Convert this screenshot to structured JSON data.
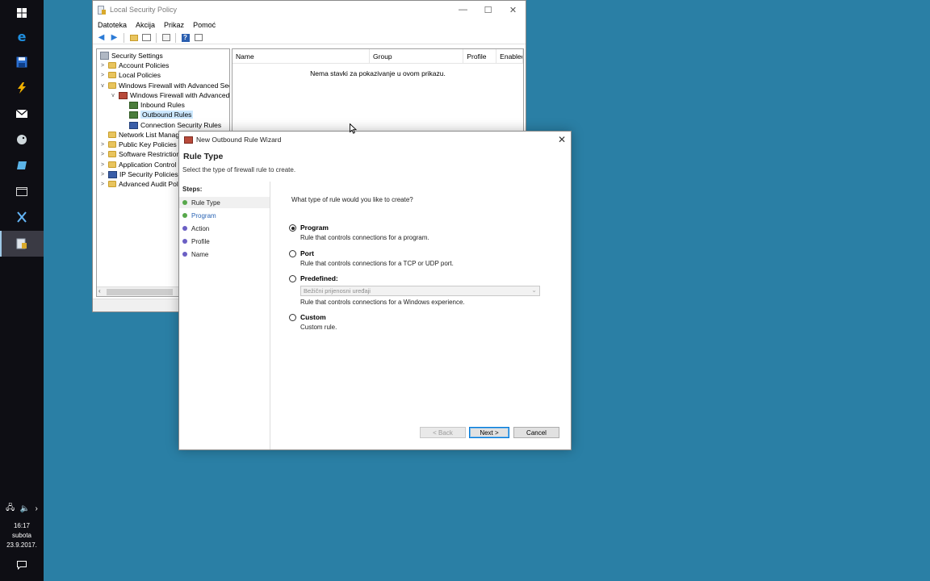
{
  "taskbar": {
    "clock": {
      "time": "16:17",
      "day": "subota",
      "date": "23.9.2017."
    }
  },
  "lsp_window": {
    "title": "Local Security Policy",
    "menu": [
      "Datoteka",
      "Akcija",
      "Prikaz",
      "Pomoć"
    ],
    "tree": [
      {
        "label": "Security Settings"
      },
      {
        "label": "Account Policies"
      },
      {
        "label": "Local Policies"
      },
      {
        "label": "Windows Firewall with Advanced Sec"
      },
      {
        "label": "Windows Firewall with Advanced"
      },
      {
        "label": "Inbound Rules"
      },
      {
        "label": "Outbound Rules"
      },
      {
        "label": "Connection Security Rules"
      },
      {
        "label": "Network List Manag"
      },
      {
        "label": "Public Key Policies"
      },
      {
        "label": "Software Restriction"
      },
      {
        "label": "Application Control"
      },
      {
        "label": "IP Security Policies o"
      },
      {
        "label": "Advanced Audit Poli"
      }
    ],
    "list_columns": [
      "Name",
      "Group",
      "Profile",
      "Enabled"
    ],
    "empty_message": "Nema stavki za pokazivanje u ovom prikazu."
  },
  "wizard": {
    "title": "New Outbound Rule Wizard",
    "page_title": "Rule Type",
    "page_subtitle": "Select the type of firewall rule to create.",
    "steps_title": "Steps:",
    "steps": [
      {
        "label": "Rule Type",
        "color": "#57a84b"
      },
      {
        "label": "Program",
        "color": "#57a84b"
      },
      {
        "label": "Action",
        "color": "#6b5fc4"
      },
      {
        "label": "Profile",
        "color": "#6b5fc4"
      },
      {
        "label": "Name",
        "color": "#6b5fc4"
      }
    ],
    "question": "What type of rule would you like to create?",
    "options": [
      {
        "label": "Program",
        "desc": "Rule that controls connections for a program.",
        "selected": true
      },
      {
        "label": "Port",
        "desc": "Rule that controls connections for a TCP or UDP port.",
        "selected": false
      },
      {
        "label": "Predefined:",
        "desc": "Rule that controls connections for a Windows experience.",
        "selected": false
      },
      {
        "label": "Custom",
        "desc": "Custom rule.",
        "selected": false
      }
    ],
    "predefined_value": "Bežični prijenosni uređaji",
    "buttons": {
      "back": "< Back",
      "next": "Next >",
      "cancel": "Cancel"
    }
  }
}
